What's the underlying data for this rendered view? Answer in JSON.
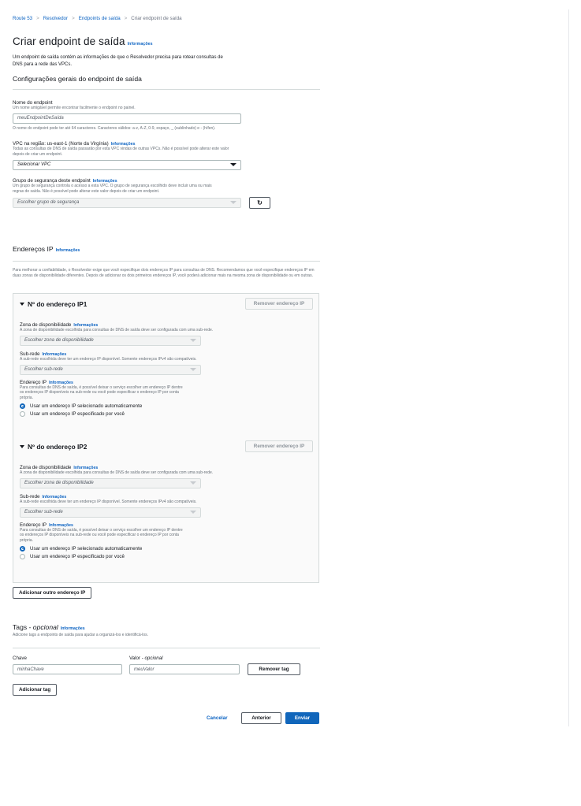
{
  "breadcrumbs": [
    "Route 53",
    "Resolvedor",
    "Endpoints de saída",
    "Criar endpoint de saída"
  ],
  "page_title": "Criar endpoint de saída",
  "info_label": "Informações",
  "page_description": "Um endpoint de saída contém as informações de que o Resolvedor precisa para rotear consultas de DNS para a rede das VPCs.",
  "general": {
    "heading": "Configurações gerais do endpoint de saída",
    "name_label": "Nome do endpoint",
    "name_hint": "Um nome amigável permite encontrar facilmente o endpoint no painel.",
    "name_value": "meuEndpointDeSaída",
    "name_constraint": "O nome do endpoint pode ter até 64 caracteres. Caracteres válidos: a-z, A-Z, 0-9, espaço, _ (sublinhado) e - (hífen).",
    "vpc_label": "VPC na região: us-east-1 (Norte da Virgínia)",
    "vpc_hint": "Todas as consultas de DNS de saída passarão por esta VPC vindas de outras VPCs. Não é possível pode alterar este valor depois de criar um endpoint.",
    "vpc_select": "Selecionar VPC",
    "sg_label": "Grupo de segurança deste endpoint",
    "sg_hint": "Um grupo de segurança controla o acesso a esta VPC. O grupo de segurança escolhido deve incluir uma ou mais regras de saída. Não é possível pode alterar este valor depois de criar um endpoint.",
    "sg_select": "Escolher grupo de segurança",
    "refresh_icon": "refresh-icon"
  },
  "ip": {
    "heading": "Endereços IP",
    "description": "Para melhorar a confiabilidade, o Resolvedor exige que você especifique dois endereços IP para consultas de DNS. Recomendamos que você especifique endereços IP em duas zonas de disponibilidade diferentes. Depois de adicionar os dois primeiros endereços IP, você poderá adicionar mais na mesma zona de disponibilidade ou em outras.",
    "remove_label": "Remover endereço IP",
    "az_label": "Zona de disponibilidade",
    "az_hint": "A zona de disponibilidade escolhida para consultas de DNS de saída deve ser configurada com uma sub-rede.",
    "az_select": "Escolher zona de disponibilidade",
    "subnet_label": "Sub-rede",
    "subnet_hint": "A sub-rede escolhida deve ter um endereço IP disponível. Somente endereços IPv4 são compatíveis.",
    "subnet_select": "Escolher sub-rede",
    "addr_label": "Endereço IP",
    "addr_hint": "Para consultas de DNS de saída, é possível deixar o serviço escolher um endereço IP dentre os endereços IP disponíveis na sub-rede ou você pode especificar o endereço IP por conta própria.",
    "radio_auto": "Usar um endereço IP selecionado automaticamente",
    "radio_manual": "Usar um endereço IP especificado por você",
    "block1_title": "Nº do endereço IP1",
    "block2_title": "Nº do endereço IP2",
    "add_button": "Adicionar outro endereço IP"
  },
  "tags": {
    "heading_main": "Tags - ",
    "heading_optional": "opcional",
    "hint": "Adicione tags a endpoints de saída para ajudar a organizá-los e identificá-los.",
    "key_label": "Chave",
    "value_label_main": "Valor - ",
    "value_label_optional": "opcional",
    "key_value": "minhaChave",
    "value_value": "meuValor",
    "remove_button": "Remover tag",
    "add_button": "Adicionar tag"
  },
  "footer": {
    "cancel": "Cancelar",
    "previous": "Anterior",
    "submit": "Enviar"
  }
}
